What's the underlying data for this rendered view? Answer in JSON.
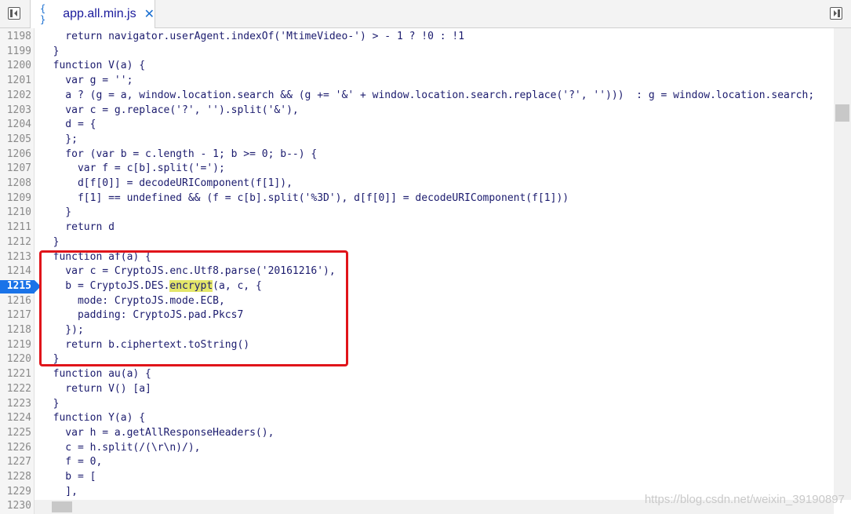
{
  "tab": {
    "icon": "{ }",
    "filename": "app.all.min.js",
    "close_glyph": "✕"
  },
  "breakpoint_line": "1215",
  "lines": [
    {
      "num": "1198",
      "code": "    return navigator.userAgent.indexOf('MtimeVideo-') > - 1 ? !0 : !1"
    },
    {
      "num": "1199",
      "code": "  }"
    },
    {
      "num": "1200",
      "code": "  function V(a) {"
    },
    {
      "num": "1201",
      "code": "    var g = '';"
    },
    {
      "num": "1202",
      "code": "    a ? (g = a, window.location.search && (g += '&' + window.location.search.replace('?', '')))  : g = window.location.search;"
    },
    {
      "num": "1203",
      "code": "    var c = g.replace('?', '').split('&'),"
    },
    {
      "num": "1204",
      "code": "    d = {"
    },
    {
      "num": "1205",
      "code": "    };"
    },
    {
      "num": "1206",
      "code": "    for (var b = c.length - 1; b >= 0; b--) {"
    },
    {
      "num": "1207",
      "code": "      var f = c[b].split('=');"
    },
    {
      "num": "1208",
      "code": "      d[f[0]] = decodeURIComponent(f[1]),"
    },
    {
      "num": "1209",
      "code": "      f[1] == undefined && (f = c[b].split('%3D'), d[f[0]] = decodeURIComponent(f[1]))"
    },
    {
      "num": "1210",
      "code": "    }"
    },
    {
      "num": "1211",
      "code": "    return d"
    },
    {
      "num": "1212",
      "code": "  }"
    },
    {
      "num": "1213",
      "code": "  function af(a) {"
    },
    {
      "num": "1214",
      "code": "    var c = CryptoJS.enc.Utf8.parse('20161216'),"
    },
    {
      "num": "1215",
      "code_pre": "    b = CryptoJS.DES.",
      "code_hl": "encrypt",
      "code_post": "(a, c, {"
    },
    {
      "num": "1216",
      "code": "      mode: CryptoJS.mode.ECB,"
    },
    {
      "num": "1217",
      "code": "      padding: CryptoJS.pad.Pkcs7"
    },
    {
      "num": "1218",
      "code": "    });"
    },
    {
      "num": "1219",
      "code": "    return b.ciphertext.toString()"
    },
    {
      "num": "1220",
      "code": "  }"
    },
    {
      "num": "1221",
      "code": "  function au(a) {"
    },
    {
      "num": "1222",
      "code": "    return V() [a]"
    },
    {
      "num": "1223",
      "code": "  }"
    },
    {
      "num": "1224",
      "code": "  function Y(a) {"
    },
    {
      "num": "1225",
      "code": "    var h = a.getAllResponseHeaders(),"
    },
    {
      "num": "1226",
      "code": "    c = h.split(/(\\r\\n)/),"
    },
    {
      "num": "1227",
      "code": "    f = 0,"
    },
    {
      "num": "1228",
      "code": "    b = ["
    },
    {
      "num": "1229",
      "code": "    ],"
    },
    {
      "num": "1230",
      "code": ""
    }
  ],
  "watermark": "https://blog.csdn.net/weixin_39190897",
  "colors": {
    "breakpoint": "#1a73e8",
    "highlight": "#e4e66a",
    "annotation_box": "#e0141a"
  }
}
